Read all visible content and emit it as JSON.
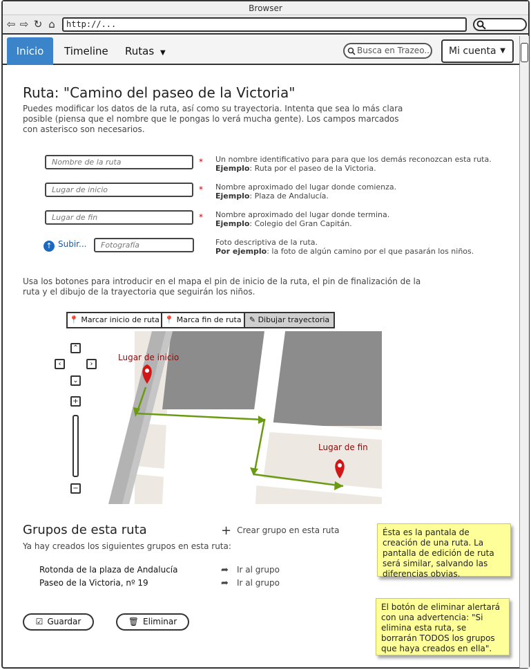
{
  "browser": {
    "title": "Browser",
    "url": "http://..."
  },
  "nav": {
    "tabs": [
      "Inicio",
      "Timeline",
      "Rutas"
    ],
    "search_placeholder": "Busca en Trazeo...",
    "account": "Mi cuenta"
  },
  "page": {
    "title": "Ruta: \"Camino del paseo de la Victoria\"",
    "intro": "Puedes modificar los datos de la ruta, así como su trayectoria. Intenta que sea lo más clara posible (piensa que el nombre que le pongas lo verá mucha gente). Los campos marcados con asterisco son necesarios."
  },
  "form": {
    "fields": [
      {
        "placeholder": "Nombre de la ruta",
        "required": "*",
        "help": "Un nombre identificativo para para que los demás reconozcan esta ruta.",
        "example_label": "Ejemplo",
        "example": ": Ruta por el paseo de la Victoria."
      },
      {
        "placeholder": "Lugar de inicio",
        "required": "*",
        "help": "Nombre aproximado del lugar donde comienza.",
        "example_label": "Ejemplo",
        "example": ": Plaza de Andalucía."
      },
      {
        "placeholder": "Lugar de fin",
        "required": "*",
        "help": "Nombre aproximado del lugar donde termina.",
        "example_label": "Ejemplo",
        "example": ": Colegio del Gran Capitán."
      },
      {
        "placeholder": "Fotografía",
        "help": "Foto descriptiva de la ruta.",
        "example_label": "Por ejemplo",
        "example": ": la foto de algún camino por el que pasarán los niños."
      }
    ],
    "upload_label": "Subir..."
  },
  "map_section": {
    "instructions": "Usa los botones para introducir en el mapa el pin de inicio de la ruta, el pin de finalización de la ruta y el dibujo de la trayectoria que seguirán los niños.",
    "toolbar": [
      "Marcar inicio de ruta",
      "Marca fin de ruta",
      "Dibujar trayectoria"
    ],
    "active_tool": "Dibujar trayectoria",
    "start_label": "Lugar de inicio",
    "end_label": "Lugar de fin",
    "pin_color": "#d01818",
    "route_color": "#6a9a10"
  },
  "groups": {
    "title": "Grupos de esta ruta",
    "subtitle": "Ya hay creados los siguientes grupos en esta ruta:",
    "create_label": "Crear grupo en esta ruta",
    "items": [
      {
        "name": "Rotonda de la plaza de Andalucía",
        "link": "Ir al grupo"
      },
      {
        "name": "Paseo de la Victoria, nº 19",
        "link": "Ir al grupo"
      }
    ]
  },
  "actions": {
    "save": "Guardar",
    "delete": "Eliminar"
  },
  "notes": [
    "Ésta es la pantala de creación de una ruta. La pantalla de edición de ruta será similar, salvando las diferencias obvias.",
    "El botón de eliminar alertará con una advertencia: \"Si elimina esta ruta, se borrarán TODOS los grupos que haya creados en ella\"."
  ],
  "colors": {
    "accent": "#3b84c9",
    "sticky": "#ffff99"
  }
}
